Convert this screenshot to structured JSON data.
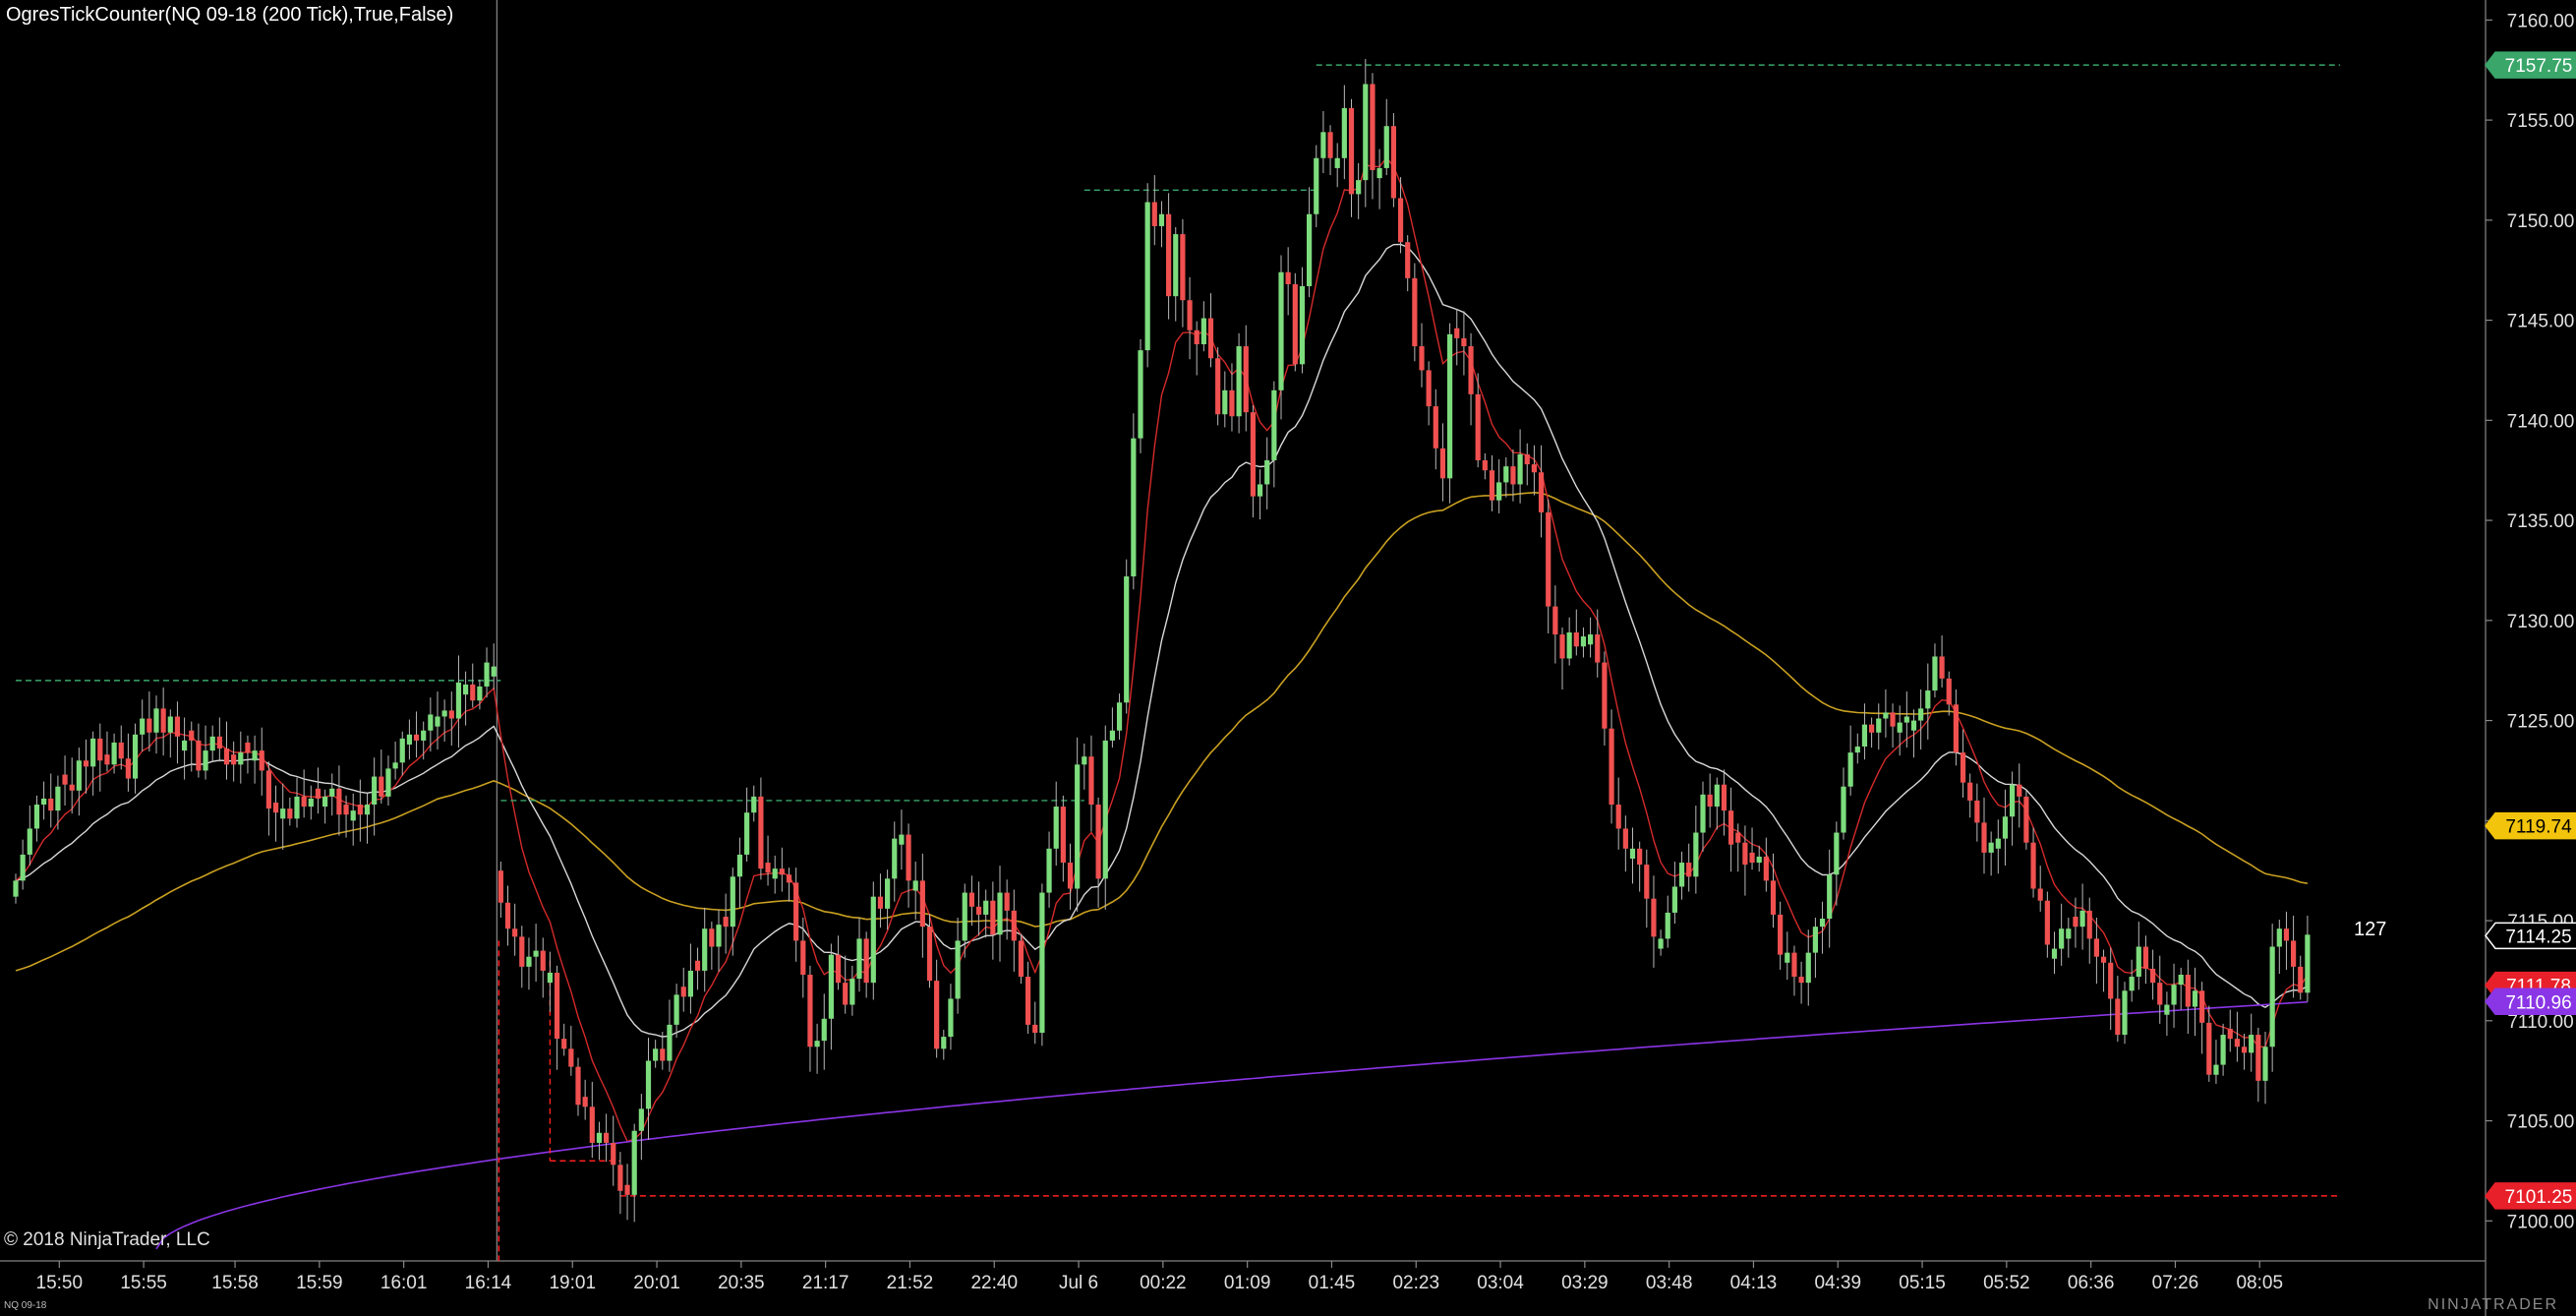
{
  "window": {
    "indicator_title": "OgresTickCounter(NQ 09-18 (200 Tick),True,False)",
    "copyright": "© 2018 NinjaTrader, LLC",
    "instrument_label": "NQ 09-18",
    "brand": "NINJATRADER",
    "tick_counter": "127"
  },
  "colors": {
    "background": "#000000",
    "up_candle": "#7ddc7d",
    "down_candle": "#f05050",
    "wick": "#b8b8b8",
    "ema_fast": "#d42a2a",
    "ema_mid": "#d8d8d8",
    "ema_slow": "#c9a020",
    "vwap": "#8a35e6",
    "high_level": "#3aa66a",
    "low_level": "#ff2020"
  },
  "chart_data": {
    "type": "candlestick",
    "title": "",
    "xlabel": "",
    "ylabel": "",
    "ylim": [
      7098.0,
      7161.0
    ],
    "y_ticks": [
      7100,
      7105,
      7110,
      7115,
      7120,
      7125,
      7130,
      7135,
      7140,
      7145,
      7150,
      7155,
      7160
    ],
    "y_tick_labels": [
      "7100.00",
      "7105.00",
      "7110.00",
      "7115.00",
      "7120.00",
      "7125.00",
      "7130.00",
      "7135.00",
      "7140.00",
      "7145.00",
      "7150.00",
      "7155.00",
      "7160.00"
    ],
    "x_tick_labels": [
      "15:50",
      "15:55",
      "15:58",
      "15:59",
      "16:01",
      "16:14",
      "19:01",
      "20:01",
      "20:35",
      "21:17",
      "21:52",
      "22:40",
      "Jul 6",
      "00:22",
      "01:09",
      "01:45",
      "02:23",
      "03:04",
      "03:29",
      "03:48",
      "04:13",
      "04:39",
      "05:15",
      "05:52",
      "06:36",
      "07:26",
      "08:05"
    ],
    "x_tick_bar_index": [
      2,
      14,
      27,
      39,
      51,
      63,
      75,
      87,
      99,
      111,
      123,
      135,
      147,
      159,
      171,
      183,
      195,
      207,
      219,
      231,
      243,
      255,
      267,
      279,
      291,
      303,
      315
    ],
    "session_break_bar": 69,
    "closes": [
      7117.0,
      7118.3,
      7119.6,
      7120.8,
      7121.1,
      7120.5,
      7121.7,
      7121.8,
      7121.5,
      7123.0,
      7122.7,
      7124.1,
      7123.0,
      7122.8,
      7123.9,
      7123.1,
      7122.1,
      7124.3,
      7125.1,
      7124.4,
      7125.6,
      7124.4,
      7125.2,
      7124.2,
      7124.0,
      7124.0,
      7122.5,
      7123.5,
      7124.2,
      7123.6,
      7122.8,
      7122.8,
      7123.4,
      7123.4,
      7123.5,
      7122.5,
      7120.6,
      7120.4,
      7120.6,
      7120.1,
      7121.2,
      7120.7,
      7121.1,
      7121.1,
      7121.2,
      7121.6,
      7120.3,
      7120.3,
      7120.5,
      7120.3,
      7120.8,
      7122.2,
      7121.2,
      7122.6,
      7122.9,
      7124.1,
      7124.3,
      7124.0,
      7124.5,
      7125.3,
      7125.2,
      7125.5,
      7125.1,
      7126.9,
      7126.8,
      7126.0,
      7126.7,
      7127.9,
      7127.7,
      7115.9,
      7114.6,
      7114.2,
      7112.7,
      7113.2,
      7113.5,
      7112.5,
      7112.4,
      7109.1,
      7108.6,
      7107.7,
      7105.8,
      7105.7,
      7103.9,
      7104.4,
      7103.9,
      7102.8,
      7101.5,
      7101.3,
      7104.5,
      7105.6,
      7108.0,
      7108.6,
      7108.0,
      7109.8,
      7111.3,
      7111.2,
      7112.5,
      7112.5,
      7114.6,
      7113.7,
      7114.8,
      7114.7,
      7117.2,
      7118.3,
      7120.4,
      7121.2,
      7117.6,
      7117.4,
      7117.6,
      7117.3,
      7116.9,
      7114.0,
      7112.3,
      7108.7,
      7109.0,
      7110.1,
      7113.3,
      7111.9,
      7110.8,
      7112.1,
      7114.1,
      7111.9,
      7116.2,
      7115.6,
      7117.1,
      7119.1,
      7119.3,
      7117.0,
      7117.0,
      7114.7,
      7112.0,
      7108.6,
      7109.2,
      7111.1,
      7114.0,
      7116.4,
      7115.7,
      7115.3,
      7116.0,
      7114.3,
      7116.4,
      7115.5,
      7114.0,
      7112.2,
      7109.8,
      7109.4,
      7116.4,
      7118.6,
      7120.7,
      7117.9,
      7116.6,
      7122.8,
      7123.2,
      7120.8,
      7117.1,
      7124.0,
      7124.5,
      7125.9,
      7132.2,
      7139.1,
      7143.5,
      7150.9,
      7149.7,
      7150.3,
      7146.2,
      7149.3,
      7146.0,
      7144.5,
      7143.8,
      7145.1,
      7143.1,
      7140.3,
      7141.5,
      7140.2,
      7143.7,
      7140.4,
      7136.2,
      7136.8,
      7138.0,
      7141.5,
      7147.4,
      7146.8,
      7142.8,
      7146.7,
      7150.3,
      7153.1,
      7154.4,
      7153.1,
      7153.1,
      7155.6,
      7151.3,
      7152.0,
      7156.8,
      7152.5,
      7152.6,
      7154.7,
      7151.1,
      7148.9,
      7147.1,
      7143.7,
      7142.5,
      7140.7,
      7138.6,
      7137.1,
      7144.3,
      7144.1,
      7143.7,
      7141.3,
      7138.0,
      7137.5,
      7136.0,
      7136.9,
      7137.7,
      7136.8,
      7138.3,
      7137.8,
      7137.4,
      7135.4,
      7130.7,
      7129.3,
      7128.1,
      7129.4,
      7128.7,
      7129.2,
      7129.3,
      7127.9,
      7124.6,
      7120.8,
      7119.6,
      7118.6,
      7118.6,
      7117.8,
      7116.1,
      7114.2,
      7114.1,
      7115.4,
      7116.7,
      7117.9,
      7117.2,
      7119.4,
      7121.3,
      7120.7,
      7121.8,
      7120.5,
      7118.8,
      7118.9,
      7117.8,
      7117.9,
      7118.2,
      7117.0,
      7115.3,
      7113.3,
      7113.4,
      7112.2,
      7111.9,
      7113.4,
      7114.7,
      7115.1,
      7117.3,
      7119.4,
      7121.7,
      7123.4,
      7123.7,
      7124.8,
      7124.4,
      7125.1,
      7125.4,
      7124.7,
      7124.9,
      7125.2,
      7125.0,
      7125.6,
      7126.5,
      7128.2,
      7127.1,
      7125.8,
      7123.4,
      7121.9,
      7121.0,
      7119.9,
      7118.4,
      7118.9,
      7119.1,
      7120.2,
      7121.8,
      7121.2,
      7118.9,
      7116.6,
      7116.0,
      7113.8,
      7113.6,
      7114.6,
      7114.6,
      7114.7,
      7115.5,
      7114.1,
      7113.2,
      7112.9,
      7111.1,
      7109.3,
      7111.5,
      7112.2,
      7113.7,
      7112.6,
      7111.9,
      7110.8,
      7110.8,
      7111.8,
      7112.3,
      7110.7,
      7111.5,
      7109.9,
      7107.3,
      7107.8,
      7109.3,
      7109.1,
      7108.7,
      7108.4,
      7109.3,
      7107.0,
      7108.7,
      7113.7,
      7114.6,
      7114.0,
      7112.7,
      7111.4,
      7114.3
    ],
    "high_level": 7157.75,
    "low_level": 7101.25,
    "price_markers": [
      {
        "label": "7157.75",
        "value": 7157.75,
        "bg": "#3aa66a",
        "fg": "#ffffff"
      },
      {
        "label": "7119.74",
        "value": 7119.74,
        "bg": "#f2c40c",
        "fg": "#000000"
      },
      {
        "label": "7114.25",
        "value": 7114.25,
        "bg": "#000000",
        "fg": "#ffffff",
        "border": "#ffffff"
      },
      {
        "label": "7111.78",
        "value": 7111.78,
        "bg": "#e8202a",
        "fg": "#ffffff"
      },
      {
        "label": "7110.96",
        "value": 7110.96,
        "bg": "#8a35e6",
        "fg": "#ffffff"
      },
      {
        "label": "7101.25",
        "value": 7101.25,
        "bg": "#e8202a",
        "fg": "#ffffff"
      }
    ]
  }
}
